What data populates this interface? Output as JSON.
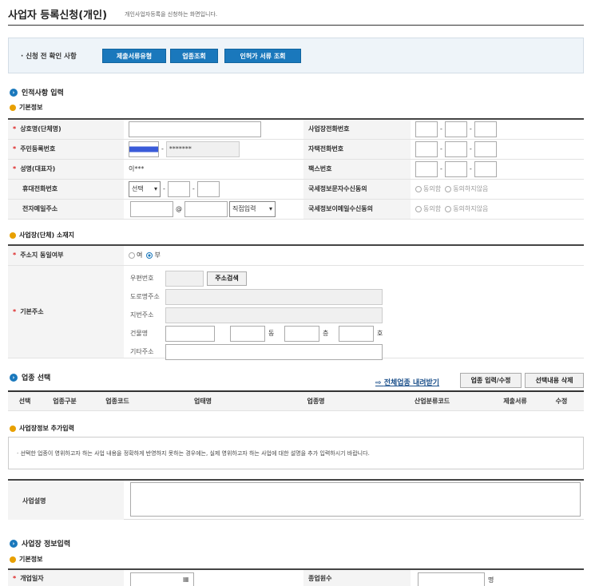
{
  "page": {
    "title": "사업자 등록신청(개인)",
    "subtitle": "개인사업자등록을 신청하는 화면입니다."
  },
  "precheck": {
    "label": "· 신청 전 확인 사항",
    "buttons": [
      "제출서류유형",
      "업종조회",
      "인허가 서류 조회"
    ]
  },
  "personal": {
    "section_title": "인적사항 입력",
    "sub_title": "기본정보",
    "rows": [
      {
        "label": "상호명(단체명)",
        "required": true,
        "right_label": "사업장전화번호"
      },
      {
        "label": "주민등록번호",
        "required": true,
        "masked": "*******",
        "right_label": "자택전화번호"
      },
      {
        "label": "성명(대표자)",
        "required": true,
        "value": "이***",
        "right_label": "팩스번호"
      },
      {
        "label": "휴대전화번호",
        "required": false,
        "select": "선택",
        "right_label": "국세정보문자수신동의",
        "opt_yes": "동의함",
        "opt_no": "동의하지않음"
      },
      {
        "label": "전자메일주소",
        "required": false,
        "at": "@",
        "select": "직접입력",
        "right_label": "국세정보이메일수신동의",
        "opt_yes": "동의함",
        "opt_no": "동의하지않음"
      }
    ]
  },
  "address": {
    "sub_title": "사업장(단체) 소재지",
    "same_label": "주소지 동일여부",
    "opt_yes": "여",
    "opt_no": "부",
    "base_label": "기본주소",
    "postal": "우편번호",
    "search_btn": "주소검색",
    "road": "도로명주소",
    "lot": "지번주소",
    "building": "건물명",
    "dong": "동",
    "floor": "층",
    "ho": "호",
    "other": "기타주소"
  },
  "industry": {
    "section_title": "업종 선택",
    "download": "전체업종 내려받기",
    "edit_btn": "업종 입력/수정",
    "delete_btn": "선택내용 삭제",
    "headers": [
      "선택",
      "업종구분",
      "업종코드",
      "업태명",
      "업종명",
      "산업분류코드",
      "제출서류",
      "수정"
    ]
  },
  "extra": {
    "sub_title": "사업장정보 추가입력",
    "notice": "· 선택한 업종이 영위하고자 하는 사업 내용을 정확하게 반영하지 못하는 경우에는, 실제 영위하고자 하는 사업에 대한 설명을 추가 입력하시기 바랍니다.",
    "desc_label": "사업설명"
  },
  "bizinfo": {
    "section_title": "사업장 정보입력",
    "sub_title": "기본정보",
    "open_date": "개업일자",
    "employees": "종업원수",
    "unit": "명"
  },
  "colors": {
    "accent": "#1a78bc",
    "required": "#d22222",
    "orange": "#e8a000"
  }
}
